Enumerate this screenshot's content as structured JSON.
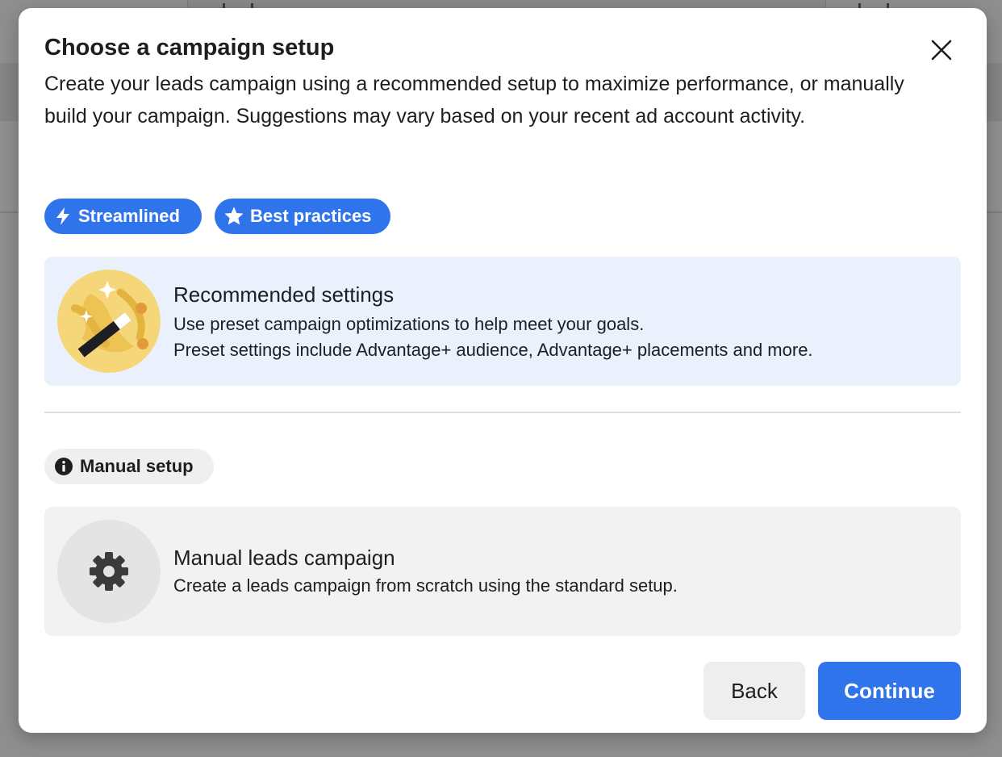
{
  "dialog": {
    "title": "Choose a campaign setup",
    "subtitle": "Create your leads campaign using a recommended setup to maximize performance, or manually build your campaign. Suggestions may vary based on your recent ad account activity.",
    "close_icon": "close-icon"
  },
  "tags": {
    "streamlined": "Streamlined",
    "best_practices": "Best practices",
    "manual_setup": "Manual setup"
  },
  "options": [
    {
      "title": "Recommended settings",
      "description_line1": "Use preset campaign optimizations to help meet your goals.",
      "description_line2": "Preset settings include Advantage+ audience, Advantage+ placements and more.",
      "icon": "magic-wand-icon"
    },
    {
      "title": "Manual leads campaign",
      "description_line1": "Create a leads campaign from scratch using the standard setup.",
      "icon": "gear-icon"
    }
  ],
  "footer": {
    "back_label": "Back",
    "continue_label": "Continue"
  },
  "colors": {
    "primary": "#2f74eb",
    "recommended_bg": "#eaf0fc",
    "manual_bg": "#f2f2f2"
  }
}
